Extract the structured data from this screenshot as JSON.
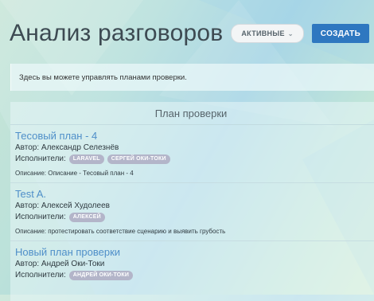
{
  "header": {
    "title": "Анализ разговоров",
    "filter_label": "АКТИВНЫЕ",
    "create_label": "СОЗДАТЬ"
  },
  "info": {
    "text": "Здесь вы можете управлять планами проверки."
  },
  "plans_panel": {
    "heading": "План проверки",
    "author_prefix": "Автор:",
    "executors_prefix": "Исполнители:",
    "plans": [
      {
        "title": "Тесовый план - 4",
        "author": "Автор: Александр Селезнёв",
        "executors_label": "Исполнители:",
        "tags": [
          "LARAVEL",
          "СЕРГЕЙ ОКИ-ТОКИ"
        ],
        "description": "Описание: Описание - Тесовый план - 4"
      },
      {
        "title": "Test A.",
        "author": "Автор: Алексей Худолеев",
        "executors_label": "Исполнители:",
        "tags": [
          "АЛЕКСЕЙ"
        ],
        "description": "Описание: протестировать соответствие сценарию и выявить грубость"
      },
      {
        "title": "Новый план проверки",
        "author": "Автор: Андрей Оки-Токи",
        "executors_label": "Исполнители:",
        "tags": [
          "АНДРЕЙ ОКИ-ТОКИ"
        ],
        "description": ""
      }
    ]
  },
  "colors": {
    "accent": "#2e77c0",
    "link": "#4f8fc9",
    "tag_bg": "#b3b5c9"
  },
  "icons": {
    "filter_dropdown": "chevron-down-icon"
  }
}
